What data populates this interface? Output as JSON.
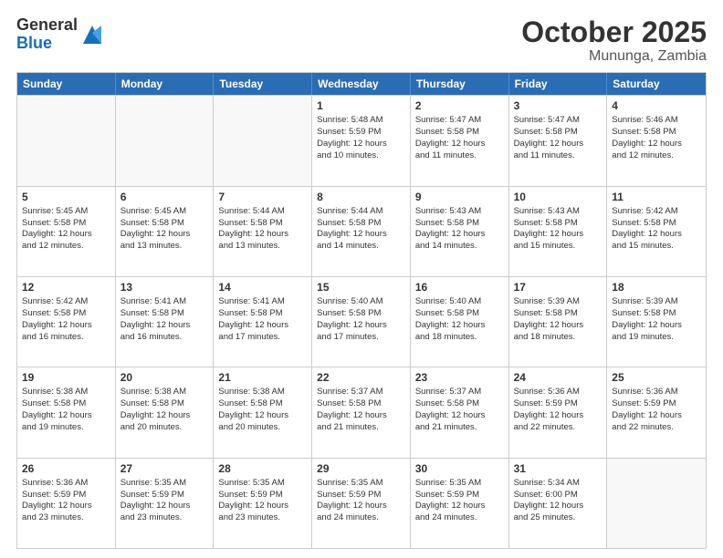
{
  "header": {
    "logo_general": "General",
    "logo_blue": "Blue",
    "month": "October 2025",
    "location": "Mununga, Zambia"
  },
  "weekdays": [
    "Sunday",
    "Monday",
    "Tuesday",
    "Wednesday",
    "Thursday",
    "Friday",
    "Saturday"
  ],
  "rows": [
    [
      {
        "day": "",
        "info": "",
        "empty": true
      },
      {
        "day": "",
        "info": "",
        "empty": true
      },
      {
        "day": "",
        "info": "",
        "empty": true
      },
      {
        "day": "1",
        "info": "Sunrise: 5:48 AM\nSunset: 5:59 PM\nDaylight: 12 hours\nand 10 minutes.",
        "empty": false
      },
      {
        "day": "2",
        "info": "Sunrise: 5:47 AM\nSunset: 5:58 PM\nDaylight: 12 hours\nand 11 minutes.",
        "empty": false
      },
      {
        "day": "3",
        "info": "Sunrise: 5:47 AM\nSunset: 5:58 PM\nDaylight: 12 hours\nand 11 minutes.",
        "empty": false
      },
      {
        "day": "4",
        "info": "Sunrise: 5:46 AM\nSunset: 5:58 PM\nDaylight: 12 hours\nand 12 minutes.",
        "empty": false
      }
    ],
    [
      {
        "day": "5",
        "info": "Sunrise: 5:45 AM\nSunset: 5:58 PM\nDaylight: 12 hours\nand 12 minutes.",
        "empty": false
      },
      {
        "day": "6",
        "info": "Sunrise: 5:45 AM\nSunset: 5:58 PM\nDaylight: 12 hours\nand 13 minutes.",
        "empty": false
      },
      {
        "day": "7",
        "info": "Sunrise: 5:44 AM\nSunset: 5:58 PM\nDaylight: 12 hours\nand 13 minutes.",
        "empty": false
      },
      {
        "day": "8",
        "info": "Sunrise: 5:44 AM\nSunset: 5:58 PM\nDaylight: 12 hours\nand 14 minutes.",
        "empty": false
      },
      {
        "day": "9",
        "info": "Sunrise: 5:43 AM\nSunset: 5:58 PM\nDaylight: 12 hours\nand 14 minutes.",
        "empty": false
      },
      {
        "day": "10",
        "info": "Sunrise: 5:43 AM\nSunset: 5:58 PM\nDaylight: 12 hours\nand 15 minutes.",
        "empty": false
      },
      {
        "day": "11",
        "info": "Sunrise: 5:42 AM\nSunset: 5:58 PM\nDaylight: 12 hours\nand 15 minutes.",
        "empty": false
      }
    ],
    [
      {
        "day": "12",
        "info": "Sunrise: 5:42 AM\nSunset: 5:58 PM\nDaylight: 12 hours\nand 16 minutes.",
        "empty": false
      },
      {
        "day": "13",
        "info": "Sunrise: 5:41 AM\nSunset: 5:58 PM\nDaylight: 12 hours\nand 16 minutes.",
        "empty": false
      },
      {
        "day": "14",
        "info": "Sunrise: 5:41 AM\nSunset: 5:58 PM\nDaylight: 12 hours\nand 17 minutes.",
        "empty": false
      },
      {
        "day": "15",
        "info": "Sunrise: 5:40 AM\nSunset: 5:58 PM\nDaylight: 12 hours\nand 17 minutes.",
        "empty": false
      },
      {
        "day": "16",
        "info": "Sunrise: 5:40 AM\nSunset: 5:58 PM\nDaylight: 12 hours\nand 18 minutes.",
        "empty": false
      },
      {
        "day": "17",
        "info": "Sunrise: 5:39 AM\nSunset: 5:58 PM\nDaylight: 12 hours\nand 18 minutes.",
        "empty": false
      },
      {
        "day": "18",
        "info": "Sunrise: 5:39 AM\nSunset: 5:58 PM\nDaylight: 12 hours\nand 19 minutes.",
        "empty": false
      }
    ],
    [
      {
        "day": "19",
        "info": "Sunrise: 5:38 AM\nSunset: 5:58 PM\nDaylight: 12 hours\nand 19 minutes.",
        "empty": false
      },
      {
        "day": "20",
        "info": "Sunrise: 5:38 AM\nSunset: 5:58 PM\nDaylight: 12 hours\nand 20 minutes.",
        "empty": false
      },
      {
        "day": "21",
        "info": "Sunrise: 5:38 AM\nSunset: 5:58 PM\nDaylight: 12 hours\nand 20 minutes.",
        "empty": false
      },
      {
        "day": "22",
        "info": "Sunrise: 5:37 AM\nSunset: 5:58 PM\nDaylight: 12 hours\nand 21 minutes.",
        "empty": false
      },
      {
        "day": "23",
        "info": "Sunrise: 5:37 AM\nSunset: 5:58 PM\nDaylight: 12 hours\nand 21 minutes.",
        "empty": false
      },
      {
        "day": "24",
        "info": "Sunrise: 5:36 AM\nSunset: 5:59 PM\nDaylight: 12 hours\nand 22 minutes.",
        "empty": false
      },
      {
        "day": "25",
        "info": "Sunrise: 5:36 AM\nSunset: 5:59 PM\nDaylight: 12 hours\nand 22 minutes.",
        "empty": false
      }
    ],
    [
      {
        "day": "26",
        "info": "Sunrise: 5:36 AM\nSunset: 5:59 PM\nDaylight: 12 hours\nand 23 minutes.",
        "empty": false
      },
      {
        "day": "27",
        "info": "Sunrise: 5:35 AM\nSunset: 5:59 PM\nDaylight: 12 hours\nand 23 minutes.",
        "empty": false
      },
      {
        "day": "28",
        "info": "Sunrise: 5:35 AM\nSunset: 5:59 PM\nDaylight: 12 hours\nand 23 minutes.",
        "empty": false
      },
      {
        "day": "29",
        "info": "Sunrise: 5:35 AM\nSunset: 5:59 PM\nDaylight: 12 hours\nand 24 minutes.",
        "empty": false
      },
      {
        "day": "30",
        "info": "Sunrise: 5:35 AM\nSunset: 5:59 PM\nDaylight: 12 hours\nand 24 minutes.",
        "empty": false
      },
      {
        "day": "31",
        "info": "Sunrise: 5:34 AM\nSunset: 6:00 PM\nDaylight: 12 hours\nand 25 minutes.",
        "empty": false
      },
      {
        "day": "",
        "info": "",
        "empty": true
      }
    ]
  ]
}
